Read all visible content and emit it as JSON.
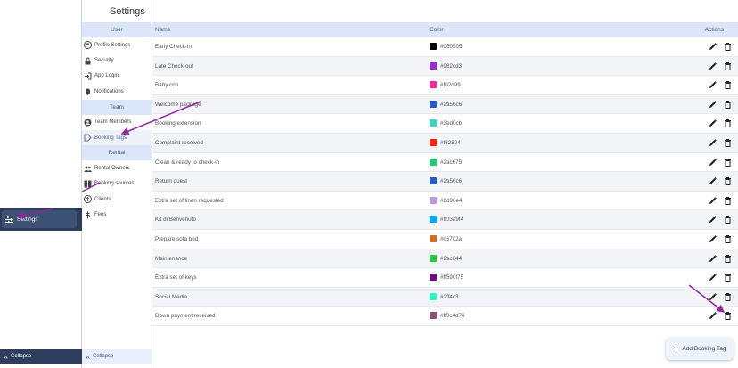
{
  "page_title": "Settings",
  "appnav": {
    "active_label": "Settings",
    "collapse_label": "Collapse"
  },
  "subnav": {
    "groups": [
      {
        "heading": "User",
        "items": [
          {
            "label": "Profile Settings",
            "icon": "account-circle-icon"
          },
          {
            "label": "Security",
            "icon": "lock-icon"
          },
          {
            "label": "App Login",
            "icon": "login-icon"
          },
          {
            "label": "Notifications",
            "icon": "bell-icon"
          }
        ]
      },
      {
        "heading": "Team",
        "items": [
          {
            "label": "Team Members",
            "icon": "team-icon"
          },
          {
            "label": "Booking Tags",
            "icon": "tag-icon",
            "active": true
          }
        ]
      },
      {
        "heading": "Rental",
        "items": [
          {
            "label": "Rental Owners",
            "icon": "owners-icon"
          },
          {
            "label": "Booking sources",
            "icon": "sources-icon"
          },
          {
            "label": "Clients",
            "icon": "clients-icon"
          },
          {
            "label": "Fees",
            "icon": "fees-icon"
          }
        ]
      }
    ],
    "collapse_label": "Collapse"
  },
  "table": {
    "headers": {
      "name": "Name",
      "color": "Color",
      "actions": "Actions"
    },
    "rows": [
      {
        "name": "Early Check-in",
        "color": "#050505"
      },
      {
        "name": "Late Check-out",
        "color": "#982cd3"
      },
      {
        "name": "Baby crib",
        "color": "#f02d99"
      },
      {
        "name": "Welcome package",
        "color": "#2a56c6"
      },
      {
        "name": "Booking extension",
        "color": "#3ed0cb"
      },
      {
        "name": "Complaint received",
        "color": "#f62804"
      },
      {
        "name": "Clean & ready to check-in",
        "color": "#2ac675"
      },
      {
        "name": "Return guest",
        "color": "#2a56c6"
      },
      {
        "name": "Extra set of linen requested",
        "color": "#bd96e4"
      },
      {
        "name": "Kit di Benvenuto",
        "color": "#ff03a9f4"
      },
      {
        "name": "Prepare sofa bed",
        "color": "#c6702a"
      },
      {
        "name": "Maintenance",
        "color": "#2ac644"
      },
      {
        "name": "Extra set of keys",
        "color": "#ff690f75"
      },
      {
        "name": "Social Media",
        "color": "#2ff4c3"
      },
      {
        "name": "Down payment received",
        "color": "#ff8c4d76"
      }
    ]
  },
  "add_button_label": "Add Booking Tag",
  "colors": {
    "nav_dark": "#2c3e5c",
    "header_bg": "#dbe6fb",
    "annotation_arrow": "#8e2a9c"
  }
}
